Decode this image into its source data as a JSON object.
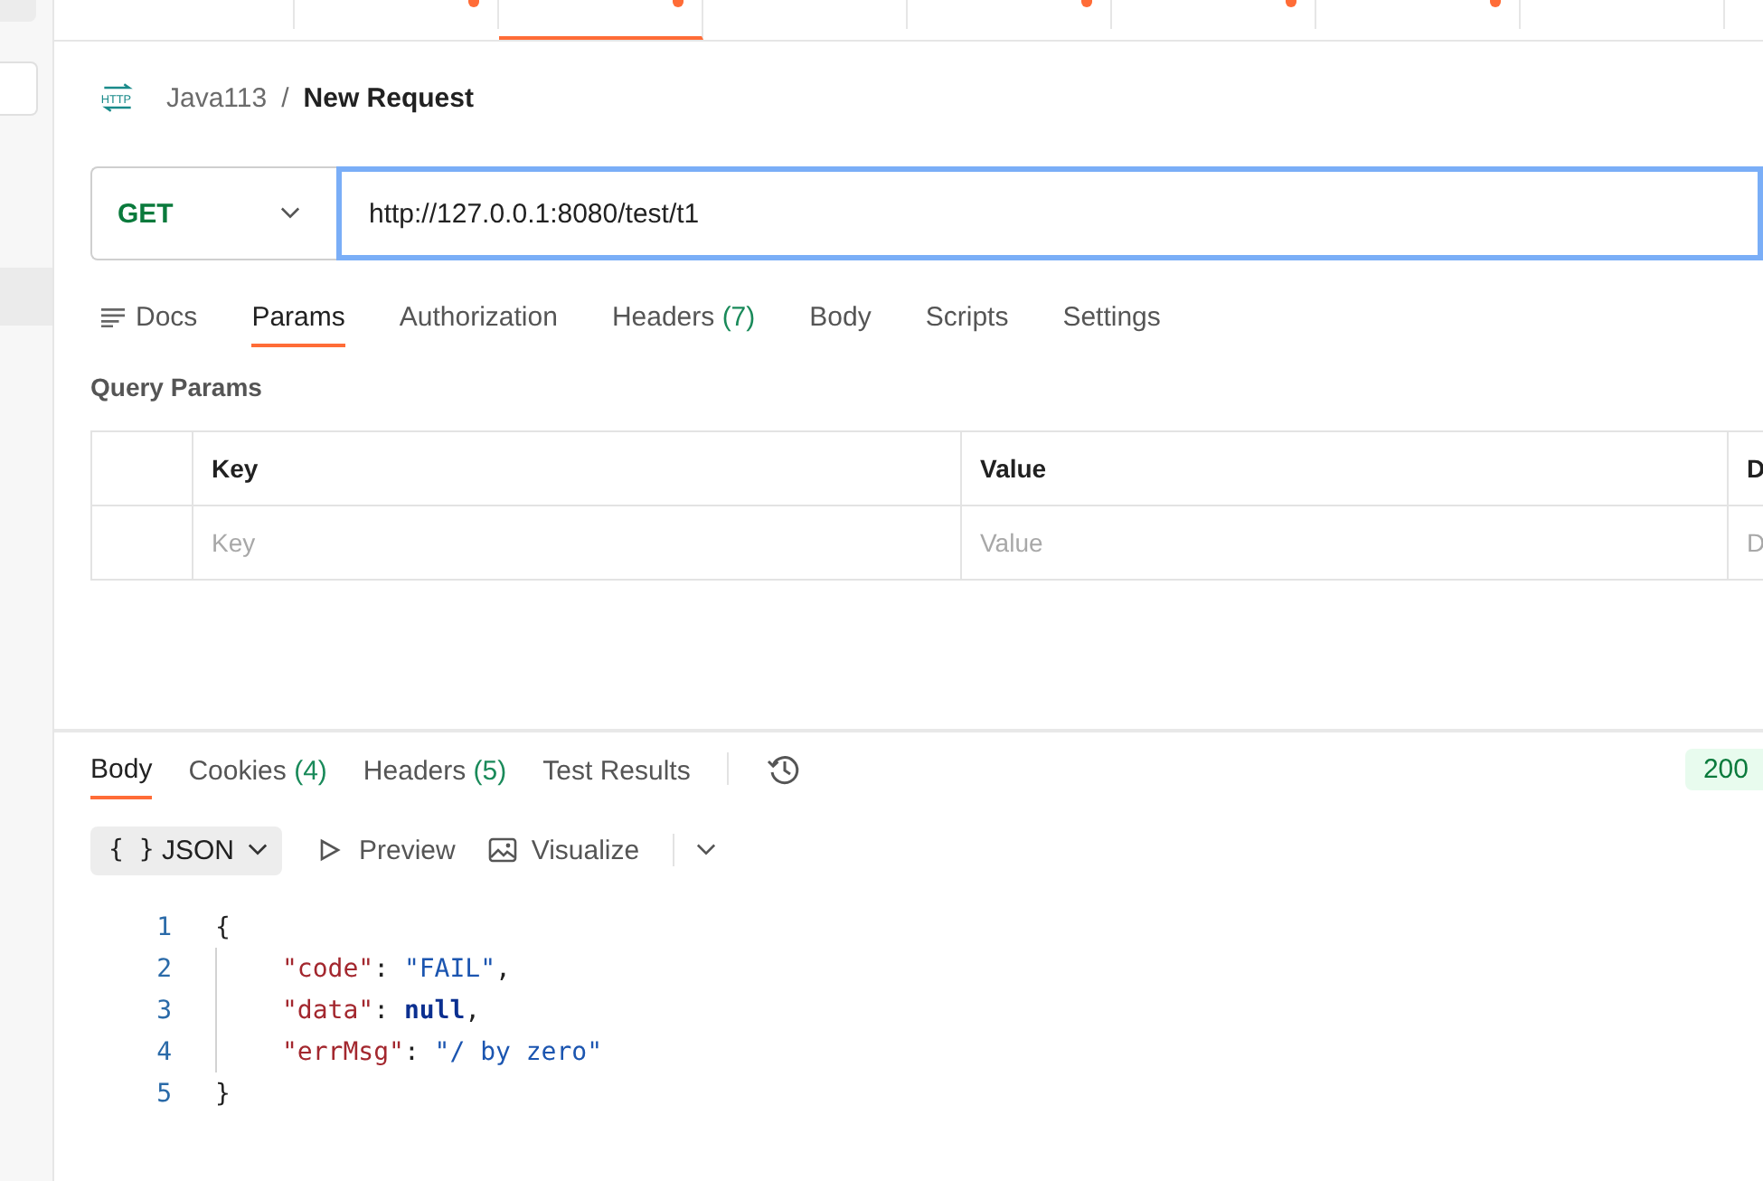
{
  "top_tabs": [
    {
      "selected": false,
      "unsaved": false
    },
    {
      "selected": false,
      "unsaved": true
    },
    {
      "selected": true,
      "unsaved": true
    },
    {
      "selected": false,
      "unsaved": false
    },
    {
      "selected": false,
      "unsaved": true
    },
    {
      "selected": false,
      "unsaved": true
    },
    {
      "selected": false,
      "unsaved": true
    },
    {
      "selected": false,
      "unsaved": false
    }
  ],
  "breadcrumb": {
    "icon_label": "HTTP",
    "collection": "Java113",
    "separator": "/",
    "request": "New Request"
  },
  "request": {
    "method": "GET",
    "url": "http://127.0.0.1:8080/test/t1"
  },
  "request_tabs": [
    {
      "label": "Docs",
      "selected": false,
      "kind": "docs"
    },
    {
      "label": "Params",
      "selected": true,
      "kind": "plain"
    },
    {
      "label": "Authorization",
      "selected": false,
      "kind": "plain"
    },
    {
      "label": "Headers",
      "count": "(7)",
      "selected": false,
      "kind": "plain"
    },
    {
      "label": "Body",
      "selected": false,
      "kind": "plain"
    },
    {
      "label": "Scripts",
      "selected": false,
      "kind": "plain"
    },
    {
      "label": "Settings",
      "selected": false,
      "kind": "plain"
    }
  ],
  "query_params": {
    "title": "Query Params",
    "columns": [
      "Key",
      "Value",
      "D"
    ],
    "placeholders": [
      "Key",
      "Value",
      "D"
    ]
  },
  "response_tabs": [
    {
      "label": "Body",
      "selected": true
    },
    {
      "label": "Cookies",
      "count": "(4)",
      "selected": false
    },
    {
      "label": "Headers",
      "count": "(5)",
      "selected": false
    },
    {
      "label": "Test Results",
      "selected": false
    }
  ],
  "status": "200",
  "format": {
    "brace": "{ }",
    "type": "JSON",
    "preview": "Preview",
    "visualize": "Visualize"
  },
  "code_lines": [
    {
      "number": "1",
      "text": "{",
      "kind": "open"
    },
    {
      "number": "2",
      "key": "\"code\"",
      "colon": ":",
      "value": "\"FAIL\"",
      "trail": ",",
      "kind": "string"
    },
    {
      "number": "3",
      "key": "\"data\"",
      "colon": ":",
      "value": "null",
      "trail": ",",
      "kind": "literal"
    },
    {
      "number": "4",
      "key": "\"errMsg\"",
      "colon": ":",
      "value": "\"/ by zero\"",
      "kind": "string"
    },
    {
      "number": "5",
      "text": "}",
      "kind": "close"
    }
  ]
}
